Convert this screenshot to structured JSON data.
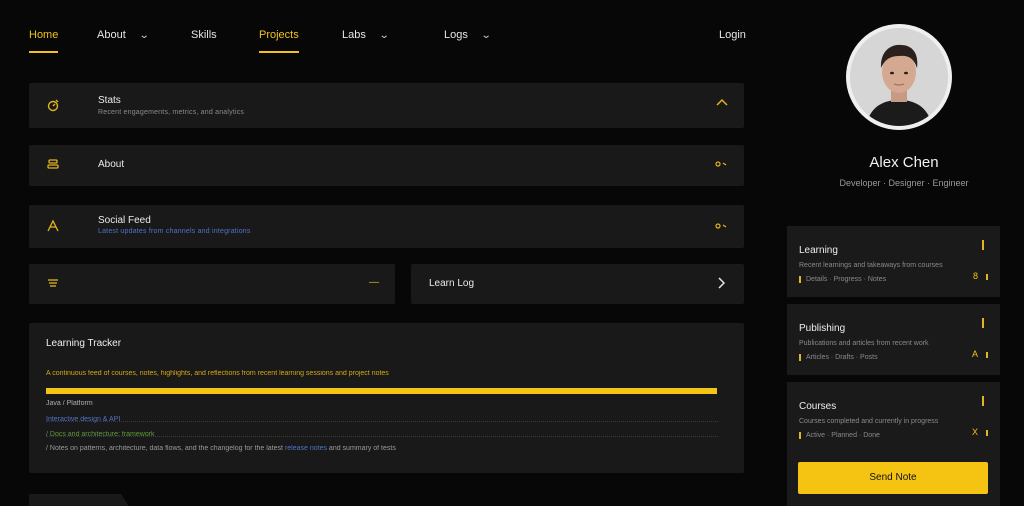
{
  "nav": {
    "items": [
      {
        "label": "Home"
      },
      {
        "label": "About"
      },
      {
        "label": "Skills"
      },
      {
        "label": "Projects"
      },
      {
        "label": "Labs"
      },
      {
        "label": "Logs"
      },
      {
        "label": "Login"
      }
    ]
  },
  "cards": {
    "stats": {
      "title": "Stats",
      "subtitle": "Recent engagements, metrics, and analytics"
    },
    "about": {
      "title": "About"
    },
    "social": {
      "title": "Social Feed",
      "subtitle": "Latest updates from channels and integrations"
    },
    "left_half": {
      "trail": "—"
    },
    "right_half": {
      "title": "Learn Log"
    }
  },
  "panel": {
    "title": "Learning Tracker",
    "line1": "A continuous feed of courses, notes, highlights, and reflections from recent learning sessions and project notes",
    "progress": 1.0,
    "line2": "Java / Platform",
    "line3": "Interactive design & API",
    "line4": "/ Docs and architecture: framework",
    "line5_a": "/ Notes on patterns, architecture, data flows, and the changelog for the latest",
    "line5_b": "release notes",
    "line5_c": "and summary of tests"
  },
  "profile": {
    "name": "Alex Chen",
    "role": "Developer · Designer · Engineer"
  },
  "side_cards": [
    {
      "title": "Learning",
      "line1": "Recent learnings and takeaways from courses",
      "line2": "Details · Progress · Notes",
      "badge": "8"
    },
    {
      "title": "Publishing",
      "line1": "Publications and articles from recent work",
      "line2": "Articles · Drafts · Posts",
      "badge": "A"
    },
    {
      "title": "Courses",
      "line1": "Courses completed and currently in progress",
      "line2": "Active · Planned · Done",
      "badge": "X"
    }
  ],
  "cta": {
    "label": "Send Note"
  },
  "colors": {
    "accent": "#f2c21b",
    "background": "#070707",
    "card": "#191919"
  }
}
